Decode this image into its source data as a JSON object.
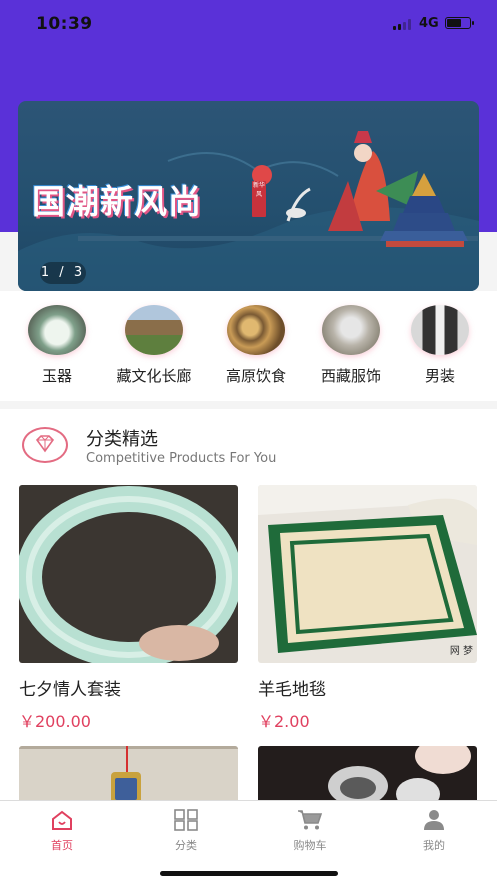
{
  "status": {
    "time": "10:39",
    "network": "4G"
  },
  "banner": {
    "title": "国潮新风尚",
    "stamp": "新华风",
    "pager": "1 / 3"
  },
  "categories": [
    {
      "label": "玉器"
    },
    {
      "label": "藏文化长廊"
    },
    {
      "label": "高原饮食"
    },
    {
      "label": "西藏服饰"
    },
    {
      "label": "男装"
    }
  ],
  "section": {
    "title": "分类精选",
    "subtitle": "Competitive Products For You"
  },
  "products": [
    {
      "name": "七夕情人套装",
      "price": "￥200.00"
    },
    {
      "name": "羊毛地毯",
      "price": "￥2.00",
      "watermark": "网 梦"
    }
  ],
  "tabs": [
    {
      "label": "首页",
      "icon": "home-icon"
    },
    {
      "label": "分类",
      "icon": "grid-icon"
    },
    {
      "label": "购物车",
      "icon": "cart-icon"
    },
    {
      "label": "我的",
      "icon": "user-icon"
    }
  ],
  "colors": {
    "accent": "#e0405f",
    "header": "#5a31d8"
  }
}
